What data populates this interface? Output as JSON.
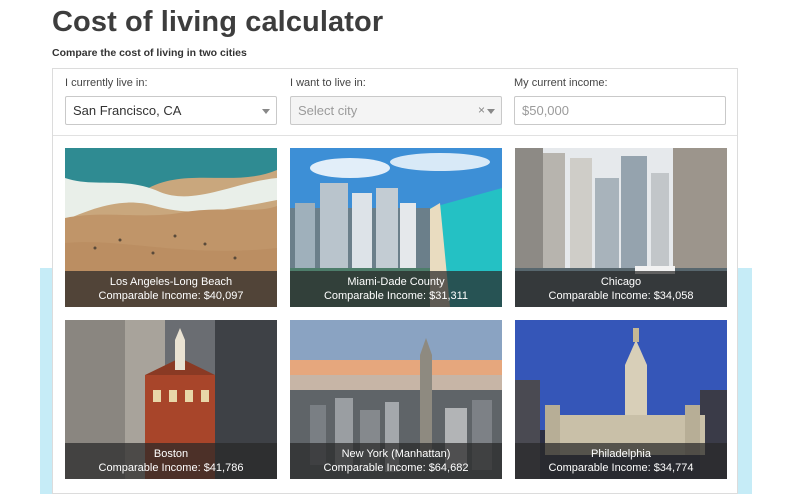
{
  "page": {
    "title": "Cost of living calculator",
    "subtitle": "Compare the cost of living in two cities"
  },
  "form": {
    "current_city": {
      "label": "I currently live in:",
      "value": "San Francisco, CA"
    },
    "target_city": {
      "label": "I want to live in:",
      "placeholder": "Select city",
      "clear_glyph": "×"
    },
    "income": {
      "label": "My current income:",
      "placeholder": "$50,000"
    }
  },
  "cities": [
    {
      "name": "Los Angeles-Long Beach",
      "income": "Comparable Income: $40,097"
    },
    {
      "name": "Miami-Dade County",
      "income": "Comparable Income: $31,311"
    },
    {
      "name": "Chicago",
      "income": "Comparable Income: $34,058"
    },
    {
      "name": "Boston",
      "income": "Comparable Income: $41,786"
    },
    {
      "name": "New York (Manhattan)",
      "income": "Comparable Income: $64,682"
    },
    {
      "name": "Philadelphia",
      "income": "Comparable Income: $34,774"
    }
  ],
  "colors": {
    "accent_band": "#c6ecf7"
  },
  "icons": {
    "dropdown": "chevron-down-icon",
    "clear": "close-icon"
  }
}
